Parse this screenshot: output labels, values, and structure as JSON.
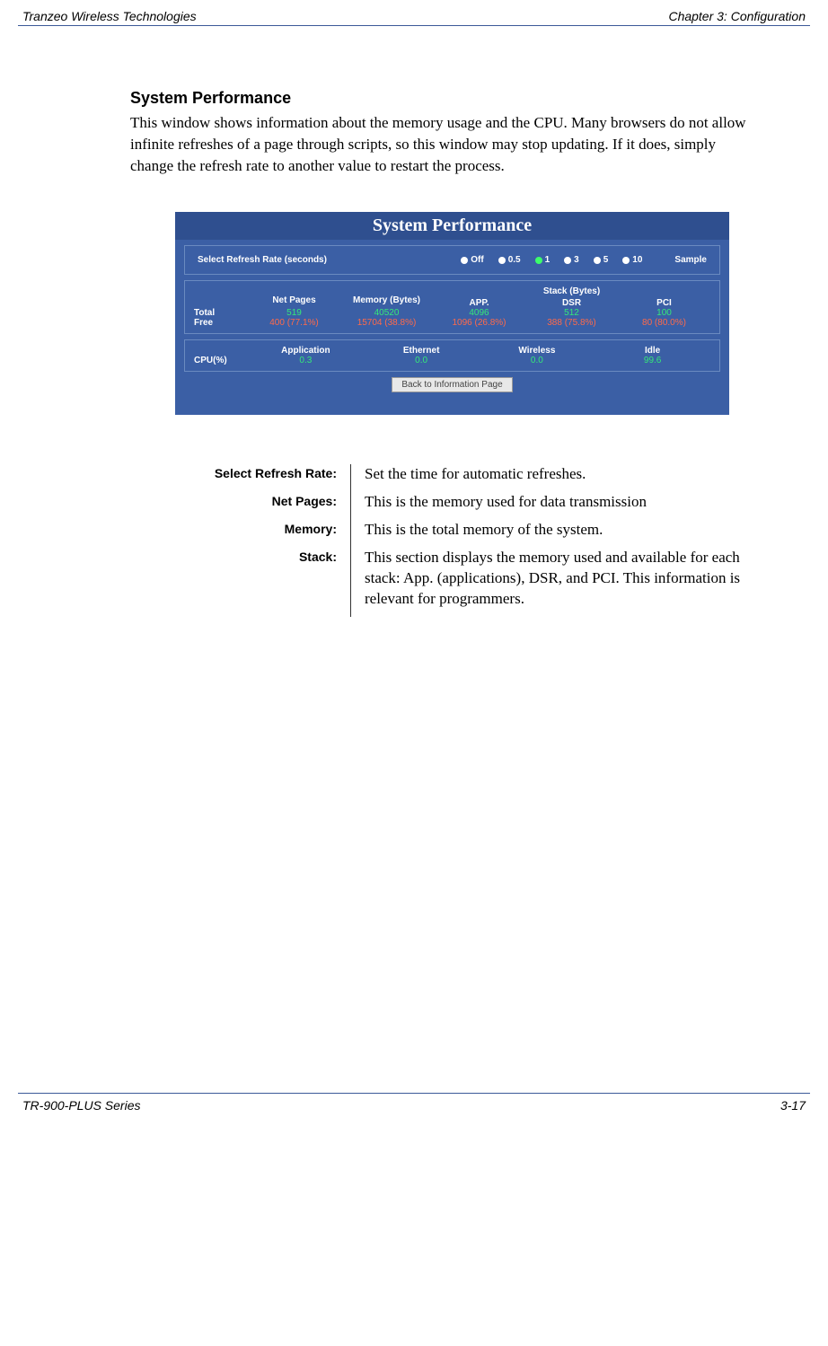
{
  "header": {
    "left": "Tranzeo Wireless Technologies",
    "right": "Chapter 3: Configuration"
  },
  "footer": {
    "left": "TR-900-PLUS Series",
    "right": "3-17"
  },
  "section": {
    "heading": "System Performance",
    "body": "This window shows information about the memory usage and the CPU. Many browsers do not allow infinite refreshes of a page through scripts, so this window may stop updating. If it does, simply change the refresh rate to another value to restart the process."
  },
  "perf_panel": {
    "title": "System Performance",
    "refresh_label": "Select Refresh Rate (seconds)",
    "refresh_options": [
      "Off",
      "0.5",
      "1",
      "3",
      "5",
      "10"
    ],
    "refresh_selected_index": 2,
    "sample_label": "Sample",
    "mem_headers": [
      "Net Pages",
      "Memory (Bytes)"
    ],
    "stack_group_label": "Stack (Bytes)",
    "stack_headers": [
      "APP.",
      "DSR",
      "PCI"
    ],
    "mem_rows": [
      {
        "label": "Total",
        "net": "519",
        "mem": "40520",
        "app": "4096",
        "dsr": "512",
        "pci": "100"
      },
      {
        "label": "Free",
        "net": "400 (77.1%)",
        "mem": "15704 (38.8%)",
        "app": "1096 (26.8%)",
        "dsr": "388 (75.8%)",
        "pci": "80 (80.0%)"
      }
    ],
    "cpu_label": "CPU(%)",
    "cpu_headers": [
      "Application",
      "Ethernet",
      "Wireless",
      "Idle"
    ],
    "cpu_values": [
      "0.3",
      "0.0",
      "0.0",
      "99.6"
    ],
    "back_button": "Back to Information Page"
  },
  "definitions": [
    {
      "label": "Select Refresh Rate:",
      "value": "Set the time for automatic refreshes."
    },
    {
      "label": "Net Pages:",
      "value": "This is the memory used for data transmission"
    },
    {
      "label": "Memory:",
      "value": "This is the total memory of the system."
    },
    {
      "label": "Stack:",
      "value": "This section displays the memory used and available for each stack: App. (applications), DSR, and PCI. This information is relevant for programmers."
    }
  ]
}
